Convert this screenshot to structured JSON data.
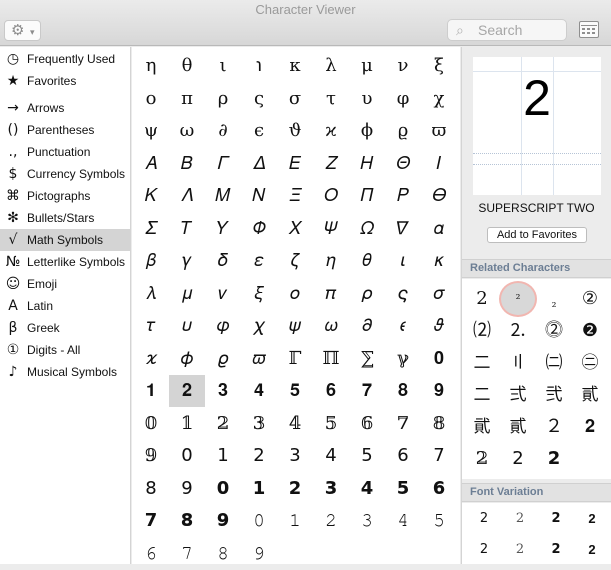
{
  "window": {
    "title": "Character Viewer"
  },
  "toolbar": {
    "gear_glyph": "⚙",
    "chevron_glyph": "▾",
    "search_icon_glyph": "⌕",
    "search_placeholder": "Search",
    "search_value": ""
  },
  "sidebar": {
    "selected": "Math Symbols",
    "items": [
      {
        "icon": "clock-icon",
        "glyph": "◷",
        "label": "Frequently Used"
      },
      {
        "icon": "star-icon",
        "glyph": "★",
        "label": "Favorites"
      },
      {
        "icon": "arrow-icon",
        "glyph": "→",
        "label": "Arrows"
      },
      {
        "icon": "parentheses-icon",
        "glyph": "()",
        "label": "Parentheses"
      },
      {
        "icon": "punctuation-icon",
        "glyph": ".,",
        "label": "Punctuation"
      },
      {
        "icon": "dollar-icon",
        "glyph": "$",
        "label": "Currency Symbols"
      },
      {
        "icon": "pictograph-icon",
        "glyph": "⌘",
        "label": "Pictographs"
      },
      {
        "icon": "asterisk-icon",
        "glyph": "✻",
        "label": "Bullets/Stars"
      },
      {
        "icon": "sqrt-icon",
        "glyph": "√",
        "label": "Math Symbols"
      },
      {
        "icon": "numero-icon",
        "glyph": "№",
        "label": "Letterlike Symbols"
      },
      {
        "icon": "smiley-icon",
        "glyph": "☺",
        "label": "Emoji"
      },
      {
        "icon": "latin-a-icon",
        "glyph": "A",
        "label": "Latin"
      },
      {
        "icon": "greek-beta-icon",
        "glyph": "β",
        "label": "Greek"
      },
      {
        "icon": "circled-one-icon",
        "glyph": "①",
        "label": "Digits - All"
      },
      {
        "icon": "music-note-icon",
        "glyph": "♪",
        "label": "Musical Symbols"
      }
    ]
  },
  "characters": [
    [
      "η",
      "θ",
      "ι",
      "℩",
      "κ",
      "λ",
      "μ",
      "ν",
      "ξ"
    ],
    [
      "ο",
      "π",
      "ρ",
      "ς",
      "σ",
      "τ",
      "υ",
      "φ",
      "χ"
    ],
    [
      "ψ",
      "ω",
      "∂",
      "ϵ",
      "ϑ",
      "ϰ",
      "ϕ",
      "ϱ",
      "ϖ"
    ],
    [
      "𝛢",
      "𝛣",
      "𝛤",
      "𝛥",
      "𝛦",
      "𝛧",
      "𝛨",
      "𝛩",
      "𝛪"
    ],
    [
      "𝛫",
      "𝛬",
      "𝛭",
      "𝛮",
      "𝛯",
      "𝛰",
      "𝛱",
      "𝛲",
      "𝛳"
    ],
    [
      "𝛴",
      "𝛵",
      "𝛶",
      "𝛷",
      "𝛸",
      "𝛹",
      "𝛺",
      "𝛻",
      "𝛼"
    ],
    [
      "𝛽",
      "𝛾",
      "𝛿",
      "𝜀",
      "𝜁",
      "𝜂",
      "𝜃",
      "𝜄",
      "𝜅"
    ],
    [
      "𝜆",
      "𝜇",
      "𝜈",
      "𝜉",
      "𝜊",
      "𝜋",
      "𝜌",
      "𝜍",
      "𝜎"
    ],
    [
      "𝜏",
      "𝜐",
      "𝜑",
      "𝜒",
      "𝜓",
      "𝜔",
      "𝜕",
      "𝜖",
      "𝜗"
    ],
    [
      "𝜘",
      "𝜙",
      "𝜚",
      "𝜛",
      "ℾ",
      "ℿ",
      "⅀",
      "ℽ",
      "𝟎"
    ],
    [
      "𝟏",
      "𝟐",
      "𝟑",
      "𝟒",
      "𝟓",
      "𝟔",
      "𝟕",
      "𝟖",
      "𝟗"
    ],
    [
      "𝟘",
      "𝟙",
      "𝟚",
      "𝟛",
      "𝟜",
      "𝟝",
      "𝟞",
      "𝟟",
      "𝟠"
    ],
    [
      "𝟡",
      "𝟢",
      "𝟣",
      "𝟤",
      "𝟥",
      "𝟦",
      "𝟧",
      "𝟨",
      "𝟩"
    ],
    [
      "𝟪",
      "𝟫",
      "𝟬",
      "𝟭",
      "𝟮",
      "𝟯",
      "𝟰",
      "𝟱",
      "𝟲"
    ],
    [
      "𝟳",
      "𝟴",
      "𝟵",
      "𝟶",
      "𝟷",
      "𝟸",
      "𝟹",
      "𝟺",
      "𝟻"
    ],
    [
      "𝟼",
      "𝟽",
      "𝟾",
      "𝟿"
    ]
  ],
  "selected_char": "𝟐",
  "detail": {
    "preview_char": "2",
    "char_name": "SUPERSCRIPT TWO",
    "add_favorites_label": "Add to Favorites",
    "related_header": "Related Characters",
    "font_variation_header": "Font Variation",
    "related": [
      [
        "2",
        "²",
        "₂",
        "②"
      ],
      [
        "⑵",
        "⒉",
        "⓶",
        "❷"
      ],
      [
        "二",
        "〢",
        "㈡",
        "㊁"
      ],
      [
        "二",
        "弍",
        "弐",
        "貳"
      ],
      [
        "貮",
        "貳",
        "２",
        "𝟐"
      ],
      [
        "𝟚",
        "𝟤",
        "𝟮"
      ]
    ],
    "highlighted_related": "²",
    "variations": [
      [
        "2",
        "2",
        "2",
        "2"
      ],
      [
        "2",
        "2",
        "2",
        "2"
      ]
    ]
  }
}
